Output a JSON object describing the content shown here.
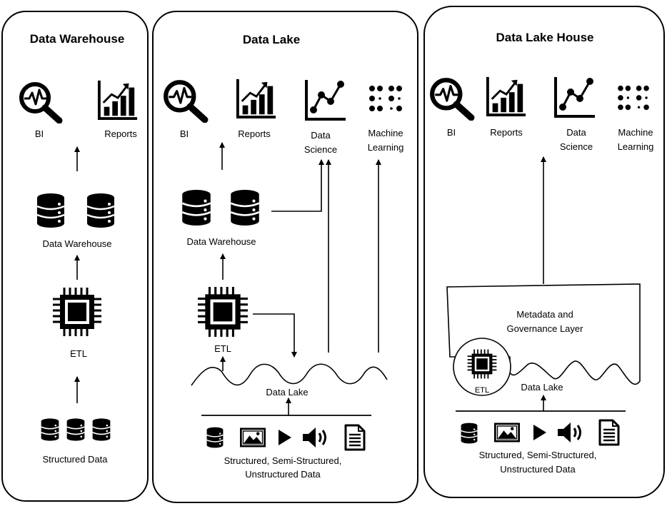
{
  "panels": {
    "warehouse": {
      "title": "Data Warehouse",
      "bi": "BI",
      "reports": "Reports",
      "store": "Data Warehouse",
      "etl": "ETL",
      "source": "Structured Data"
    },
    "lake": {
      "title": "Data Lake",
      "bi": "BI",
      "reports": "Reports",
      "ds1": "Data",
      "ds2": "Science",
      "ml1": "Machine",
      "ml2": "Learning",
      "warehouse": "Data Warehouse",
      "etl": "ETL",
      "lake": "Data Lake",
      "src1": "Structured, Semi-Structured,",
      "src2": "Unstructured Data"
    },
    "lakehouse": {
      "title": "Data Lake House",
      "bi": "BI",
      "reports": "Reports",
      "ds1": "Data",
      "ds2": "Science",
      "ml1": "Machine",
      "ml2": "Learning",
      "meta1": "Metadata and",
      "meta2": "Governance Layer",
      "etl": "ETL",
      "lake": "Data Lake",
      "src1": "Structured, Semi-Structured,",
      "src2": "Unstructured Data"
    }
  },
  "icons": [
    "magnifier-pulse-icon",
    "bar-chart-icon",
    "line-chart-icon",
    "braille-dots-icon",
    "database-icon",
    "cpu-chip-icon",
    "image-icon",
    "play-icon",
    "speaker-icon",
    "document-icon"
  ]
}
